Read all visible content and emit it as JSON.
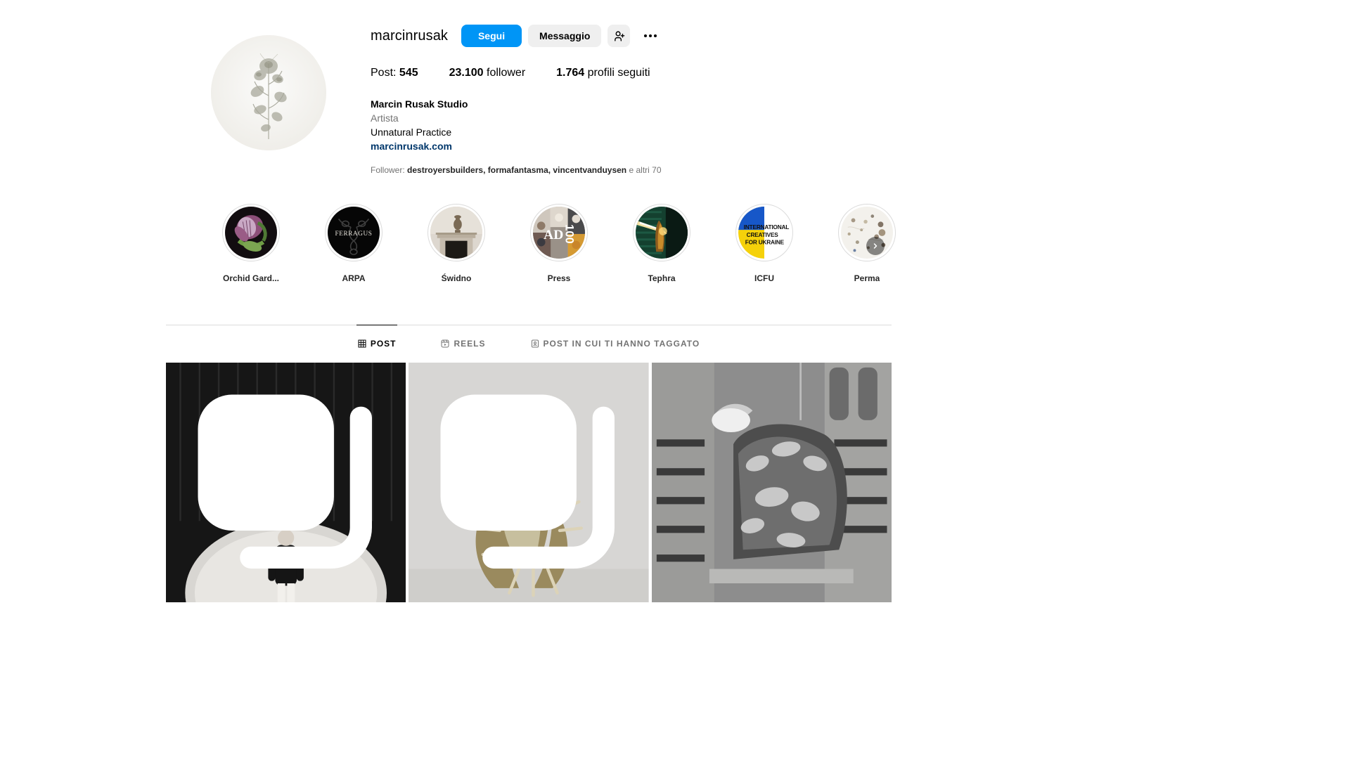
{
  "profile": {
    "username": "marcinrusak",
    "avatar_alt": "profile-picture",
    "follow_label": "Segui",
    "message_label": "Messaggio",
    "add_person_icon": "add-person-icon",
    "more_options_icon": "more-options-icon",
    "stats": {
      "posts_label": "Post:",
      "posts_value": "545",
      "followers_value": "23.100",
      "followers_label": "follower",
      "following_value": "1.764",
      "following_label": "profili seguiti"
    },
    "bio": {
      "full_name": "Marcin Rusak Studio",
      "category": "Artista",
      "line1": "Unnatural Practice",
      "link": "marcinrusak.com"
    },
    "mutuals": {
      "prefix": "Follower:",
      "names": "destroyersbuilders, formafantasma, vincentvanduysen",
      "suffix": "e altri 70"
    }
  },
  "highlights": [
    {
      "label": "Orchid Gard...",
      "theme": "orchid"
    },
    {
      "label": "ARPA",
      "theme": "ferragus"
    },
    {
      "label": "Świdno",
      "theme": "interior"
    },
    {
      "label": "Press",
      "theme": "ad100"
    },
    {
      "label": "Tephra",
      "theme": "tephra"
    },
    {
      "label": "ICFU",
      "theme": "icfu"
    },
    {
      "label": "Perma",
      "theme": "perma"
    }
  ],
  "highlights_next_icon": "chevron-right-icon",
  "tabs": [
    {
      "label": "POST",
      "icon": "grid-icon",
      "active": true
    },
    {
      "label": "REELS",
      "icon": "reels-icon",
      "active": false
    },
    {
      "label": "POST IN CUI TI HANNO TAGGATO",
      "icon": "tagged-icon",
      "active": false
    }
  ],
  "posts": [
    {
      "theme": "dark-oval",
      "carousel": true
    },
    {
      "theme": "sculpture",
      "carousel": true
    },
    {
      "theme": "metal",
      "carousel": false
    }
  ],
  "colors": {
    "accent_blue": "#0095f6",
    "link_blue": "#00376b",
    "button_gray": "#efefef",
    "text_secondary": "#737373",
    "border": "#dbdbdb"
  },
  "icfu_badge": {
    "line1": "INTERNATIONAL",
    "line2": "CREATIVES",
    "line3": "FOR UKRAINE"
  },
  "ferragus_text": "FERRAGUS",
  "ad_text": "AD",
  "ad_number": "100"
}
